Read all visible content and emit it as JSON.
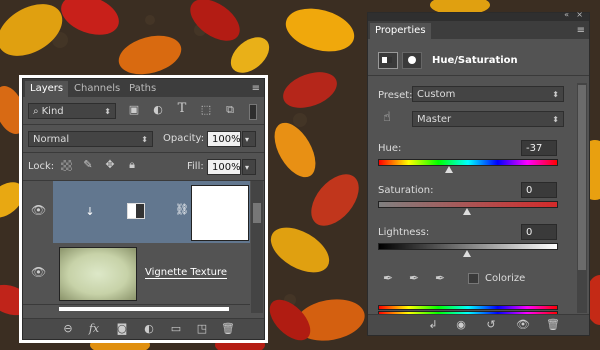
{
  "layers_panel": {
    "tabs": [
      {
        "label": "Layers",
        "active": true
      },
      {
        "label": "Channels",
        "active": false
      },
      {
        "label": "Paths",
        "active": false
      }
    ],
    "filter_kind": "Kind",
    "blend_mode": "Normal",
    "opacity_label": "Opacity:",
    "opacity_value": "100%",
    "lock_label": "Lock:",
    "fill_label": "Fill:",
    "fill_value": "100%",
    "layers": [
      {
        "name": "",
        "type": "adjustment",
        "selected": true
      },
      {
        "name": "Vignette Texture",
        "type": "image",
        "selected": false
      }
    ],
    "bottom_icons": [
      "link-icon",
      "fx-icon",
      "mask-icon",
      "adjustment-icon",
      "folder-icon",
      "new-layer-icon",
      "trash-icon"
    ]
  },
  "properties_panel": {
    "tab": "Properties",
    "adjustment_title": "Hue/Saturation",
    "preset_label": "Preset:",
    "preset_value": "Custom",
    "channel_value": "Master",
    "hue_label": "Hue:",
    "hue_value": "-37",
    "saturation_label": "Saturation:",
    "saturation_value": "0",
    "lightness_label": "Lightness:",
    "lightness_value": "0",
    "colorize_label": "Colorize",
    "colorize_checked": false,
    "hue_fraction": 0.4,
    "saturation_fraction": 0.5,
    "lightness_fraction": 0.5
  }
}
